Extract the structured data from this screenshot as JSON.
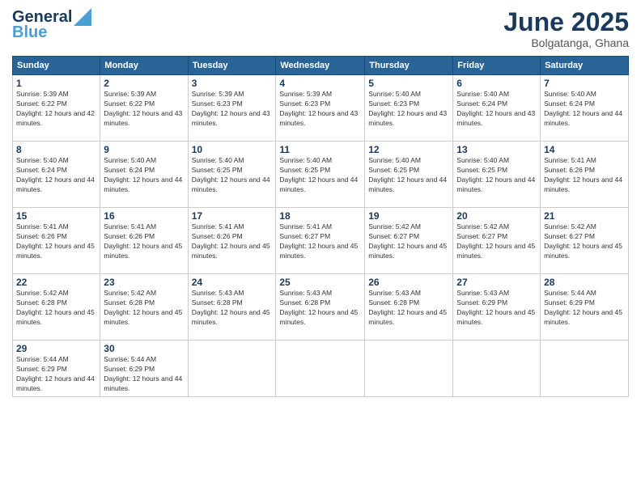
{
  "logo": {
    "line1": "General",
    "line2": "Blue"
  },
  "title": "June 2025",
  "location": "Bolgatanga, Ghana",
  "days_of_week": [
    "Sunday",
    "Monday",
    "Tuesday",
    "Wednesday",
    "Thursday",
    "Friday",
    "Saturday"
  ],
  "weeks": [
    [
      {
        "day": "1",
        "sunrise": "5:39 AM",
        "sunset": "6:22 PM",
        "daylight": "12 hours and 42 minutes."
      },
      {
        "day": "2",
        "sunrise": "5:39 AM",
        "sunset": "6:22 PM",
        "daylight": "12 hours and 43 minutes."
      },
      {
        "day": "3",
        "sunrise": "5:39 AM",
        "sunset": "6:23 PM",
        "daylight": "12 hours and 43 minutes."
      },
      {
        "day": "4",
        "sunrise": "5:39 AM",
        "sunset": "6:23 PM",
        "daylight": "12 hours and 43 minutes."
      },
      {
        "day": "5",
        "sunrise": "5:40 AM",
        "sunset": "6:23 PM",
        "daylight": "12 hours and 43 minutes."
      },
      {
        "day": "6",
        "sunrise": "5:40 AM",
        "sunset": "6:24 PM",
        "daylight": "12 hours and 43 minutes."
      },
      {
        "day": "7",
        "sunrise": "5:40 AM",
        "sunset": "6:24 PM",
        "daylight": "12 hours and 44 minutes."
      }
    ],
    [
      {
        "day": "8",
        "sunrise": "5:40 AM",
        "sunset": "6:24 PM",
        "daylight": "12 hours and 44 minutes."
      },
      {
        "day": "9",
        "sunrise": "5:40 AM",
        "sunset": "6:24 PM",
        "daylight": "12 hours and 44 minutes."
      },
      {
        "day": "10",
        "sunrise": "5:40 AM",
        "sunset": "6:25 PM",
        "daylight": "12 hours and 44 minutes."
      },
      {
        "day": "11",
        "sunrise": "5:40 AM",
        "sunset": "6:25 PM",
        "daylight": "12 hours and 44 minutes."
      },
      {
        "day": "12",
        "sunrise": "5:40 AM",
        "sunset": "6:25 PM",
        "daylight": "12 hours and 44 minutes."
      },
      {
        "day": "13",
        "sunrise": "5:40 AM",
        "sunset": "6:25 PM",
        "daylight": "12 hours and 44 minutes."
      },
      {
        "day": "14",
        "sunrise": "5:41 AM",
        "sunset": "6:26 PM",
        "daylight": "12 hours and 44 minutes."
      }
    ],
    [
      {
        "day": "15",
        "sunrise": "5:41 AM",
        "sunset": "6:26 PM",
        "daylight": "12 hours and 45 minutes."
      },
      {
        "day": "16",
        "sunrise": "5:41 AM",
        "sunset": "6:26 PM",
        "daylight": "12 hours and 45 minutes."
      },
      {
        "day": "17",
        "sunrise": "5:41 AM",
        "sunset": "6:26 PM",
        "daylight": "12 hours and 45 minutes."
      },
      {
        "day": "18",
        "sunrise": "5:41 AM",
        "sunset": "6:27 PM",
        "daylight": "12 hours and 45 minutes."
      },
      {
        "day": "19",
        "sunrise": "5:42 AM",
        "sunset": "6:27 PM",
        "daylight": "12 hours and 45 minutes."
      },
      {
        "day": "20",
        "sunrise": "5:42 AM",
        "sunset": "6:27 PM",
        "daylight": "12 hours and 45 minutes."
      },
      {
        "day": "21",
        "sunrise": "5:42 AM",
        "sunset": "6:27 PM",
        "daylight": "12 hours and 45 minutes."
      }
    ],
    [
      {
        "day": "22",
        "sunrise": "5:42 AM",
        "sunset": "6:28 PM",
        "daylight": "12 hours and 45 minutes."
      },
      {
        "day": "23",
        "sunrise": "5:42 AM",
        "sunset": "6:28 PM",
        "daylight": "12 hours and 45 minutes."
      },
      {
        "day": "24",
        "sunrise": "5:43 AM",
        "sunset": "6:28 PM",
        "daylight": "12 hours and 45 minutes."
      },
      {
        "day": "25",
        "sunrise": "5:43 AM",
        "sunset": "6:28 PM",
        "daylight": "12 hours and 45 minutes."
      },
      {
        "day": "26",
        "sunrise": "5:43 AM",
        "sunset": "6:28 PM",
        "daylight": "12 hours and 45 minutes."
      },
      {
        "day": "27",
        "sunrise": "5:43 AM",
        "sunset": "6:29 PM",
        "daylight": "12 hours and 45 minutes."
      },
      {
        "day": "28",
        "sunrise": "5:44 AM",
        "sunset": "6:29 PM",
        "daylight": "12 hours and 45 minutes."
      }
    ],
    [
      {
        "day": "29",
        "sunrise": "5:44 AM",
        "sunset": "6:29 PM",
        "daylight": "12 hours and 44 minutes."
      },
      {
        "day": "30",
        "sunrise": "5:44 AM",
        "sunset": "6:29 PM",
        "daylight": "12 hours and 44 minutes."
      },
      null,
      null,
      null,
      null,
      null
    ]
  ]
}
